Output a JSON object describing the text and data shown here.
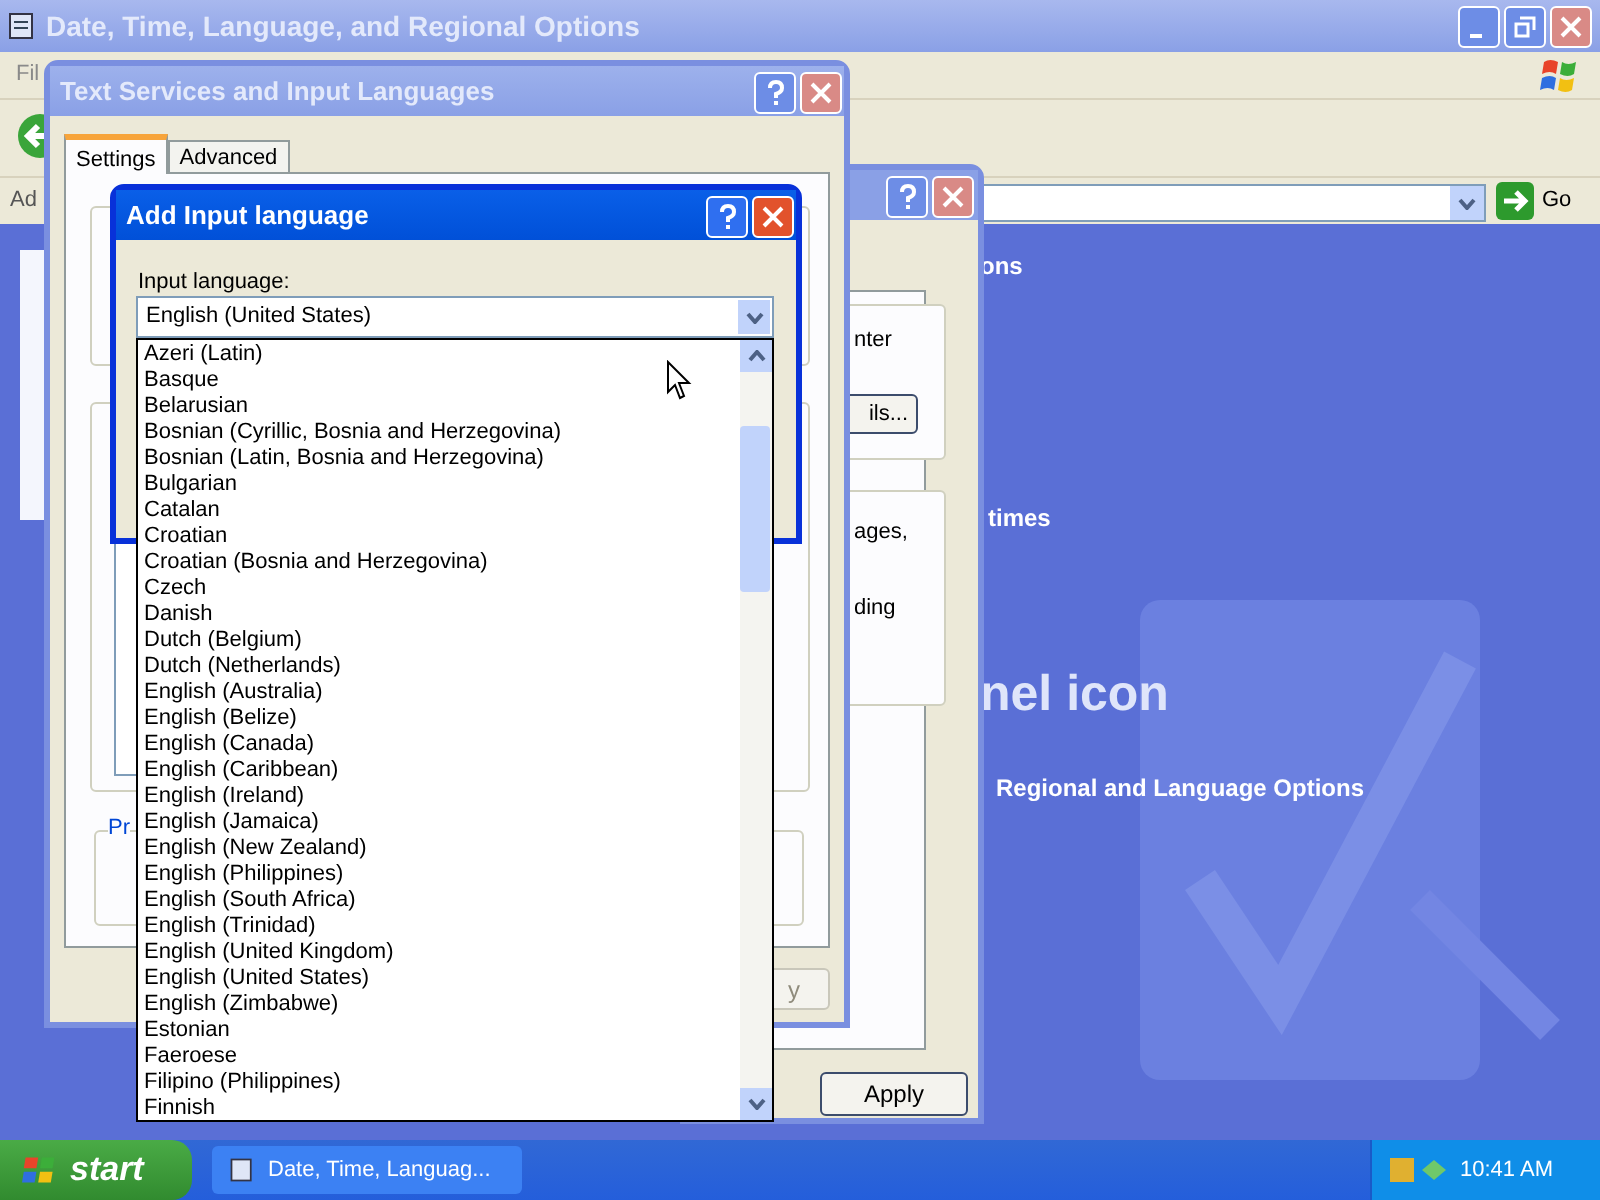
{
  "main_window": {
    "title": "Date, Time, Language, and Regional Options",
    "menu_bar": [
      "Fil"
    ],
    "address_label": "Ad",
    "go_button": "Go",
    "content": {
      "heading_fragment": "ons",
      "section_fragment": "times",
      "big_text_fragment": "nel icon",
      "link": "Regional and Language Options"
    }
  },
  "regional_dialog": {
    "text_fragments": [
      "nter",
      "ages,",
      "ding"
    ],
    "details_button": "ils...",
    "apply_button": "Apply"
  },
  "text_services_dialog": {
    "title": "Text Services and Input Languages",
    "tabs": [
      {
        "label": "Settings",
        "selected": true
      },
      {
        "label": "Advanced",
        "selected": false
      }
    ],
    "group_label": "Pr",
    "apply_button": {
      "label": "y",
      "disabled": true
    }
  },
  "add_input_dialog": {
    "title": "Add Input language",
    "field_label": "Input language:",
    "combo_value": "English (United States)",
    "list": [
      {
        "label": "Azeri (Latin)",
        "selected": false
      },
      {
        "label": "Basque",
        "selected": false
      },
      {
        "label": "Belarusian",
        "selected": false
      },
      {
        "label": "Bosnian (Cyrillic, Bosnia and Herzegovina)",
        "selected": false
      },
      {
        "label": "Bosnian (Latin, Bosnia and Herzegovina)",
        "selected": false
      },
      {
        "label": "Bulgarian",
        "selected": false
      },
      {
        "label": "Catalan",
        "selected": false
      },
      {
        "label": "Croatian",
        "selected": false
      },
      {
        "label": "Croatian (Bosnia and Herzegovina)",
        "selected": false
      },
      {
        "label": "Czech",
        "selected": false
      },
      {
        "label": "Danish",
        "selected": false
      },
      {
        "label": "Dutch (Belgium)",
        "selected": false
      },
      {
        "label": "Dutch (Netherlands)",
        "selected": false
      },
      {
        "label": "English (Australia)",
        "selected": false
      },
      {
        "label": "English (Belize)",
        "selected": false
      },
      {
        "label": "English (Canada)",
        "selected": false
      },
      {
        "label": "English (Caribbean)",
        "selected": false
      },
      {
        "label": "English (Ireland)",
        "selected": false
      },
      {
        "label": "English (Jamaica)",
        "selected": false
      },
      {
        "label": "English (New Zealand)",
        "selected": false
      },
      {
        "label": "English (Philippines)",
        "selected": false
      },
      {
        "label": "English (South Africa)",
        "selected": false
      },
      {
        "label": "English (Trinidad)",
        "selected": false
      },
      {
        "label": "English (United Kingdom)",
        "selected": false
      },
      {
        "label": "English (United States)",
        "selected": false
      },
      {
        "label": "English (Zimbabwe)",
        "selected": false
      },
      {
        "label": "Estonian",
        "selected": false
      },
      {
        "label": "Faeroese",
        "selected": false
      },
      {
        "label": "Filipino (Philippines)",
        "selected": false
      },
      {
        "label": "Finnish",
        "selected": false
      }
    ]
  },
  "taskbar": {
    "start": "start",
    "tasks": [
      {
        "label": "Date, Time, Languag..."
      }
    ],
    "clock": "10:41 AM"
  }
}
